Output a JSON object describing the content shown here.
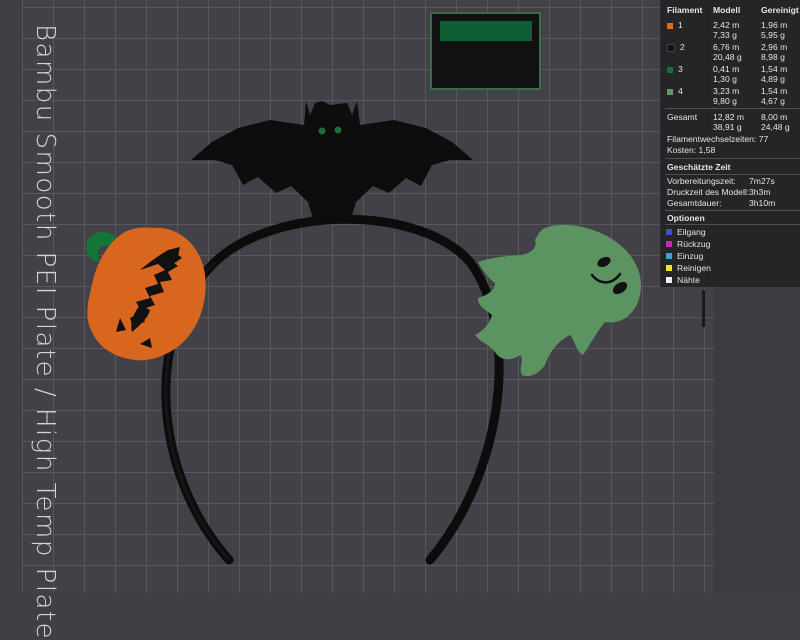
{
  "plate": {
    "label": "Bambu Smooth PEI Plate / High Temp Plate"
  },
  "objects": {
    "bat": "bat-icon",
    "pumpkin": "pumpkin-icon",
    "ghost": "ghost-icon",
    "headband": "headband"
  },
  "stats": {
    "headers": {
      "filament": "Filament",
      "model": "Modell",
      "cleaned": "Gereinigt"
    },
    "filaments": [
      {
        "id": "1",
        "color": "#e06a1b",
        "model_m": "2,42 m",
        "model_g": "7,33 g",
        "clean_m": "1,96 m",
        "clean_g": "5,95 g"
      },
      {
        "id": "2",
        "color": "#111111",
        "model_m": "6,76 m",
        "model_g": "20,48 g",
        "clean_m": "2,96 m",
        "clean_g": "8,98 g"
      },
      {
        "id": "3",
        "color": "#15703d",
        "model_m": "0,41 m",
        "model_g": "1,30 g",
        "clean_m": "1,54 m",
        "clean_g": "4,89 g"
      },
      {
        "id": "4",
        "color": "#5d9a63",
        "model_m": "3,23 m",
        "model_g": "9,80 g",
        "clean_m": "1,54 m",
        "clean_g": "4,67 g"
      }
    ],
    "total": {
      "label": "Gesamt",
      "model_m": "12,82 m",
      "model_g": "38,91 g",
      "clean_m": "8,00 m",
      "clean_g": "24,48 g"
    },
    "changes": "Filamentwechselzeiten:  77",
    "cost": "Kosten:  1,58",
    "time_header": "Geschätzte Zeit",
    "prep_label": "Vorbereitungszeit:",
    "prep_value": "7m27s",
    "print_label": "Druckzeit des Modell:",
    "print_value": "3h3m",
    "total_time_label": "Gesamtdauer:",
    "total_time_value": "3h10m",
    "options_header": "Optionen",
    "options": [
      {
        "label": "Eilgang",
        "color": "#3c53c8"
      },
      {
        "label": "Rückzug",
        "color": "#c228c4"
      },
      {
        "label": "Einzug",
        "color": "#35a8d9"
      },
      {
        "label": "Reinigen",
        "color": "#f0e52d"
      },
      {
        "label": "Nähte",
        "color": "#f1f1f1"
      }
    ]
  }
}
